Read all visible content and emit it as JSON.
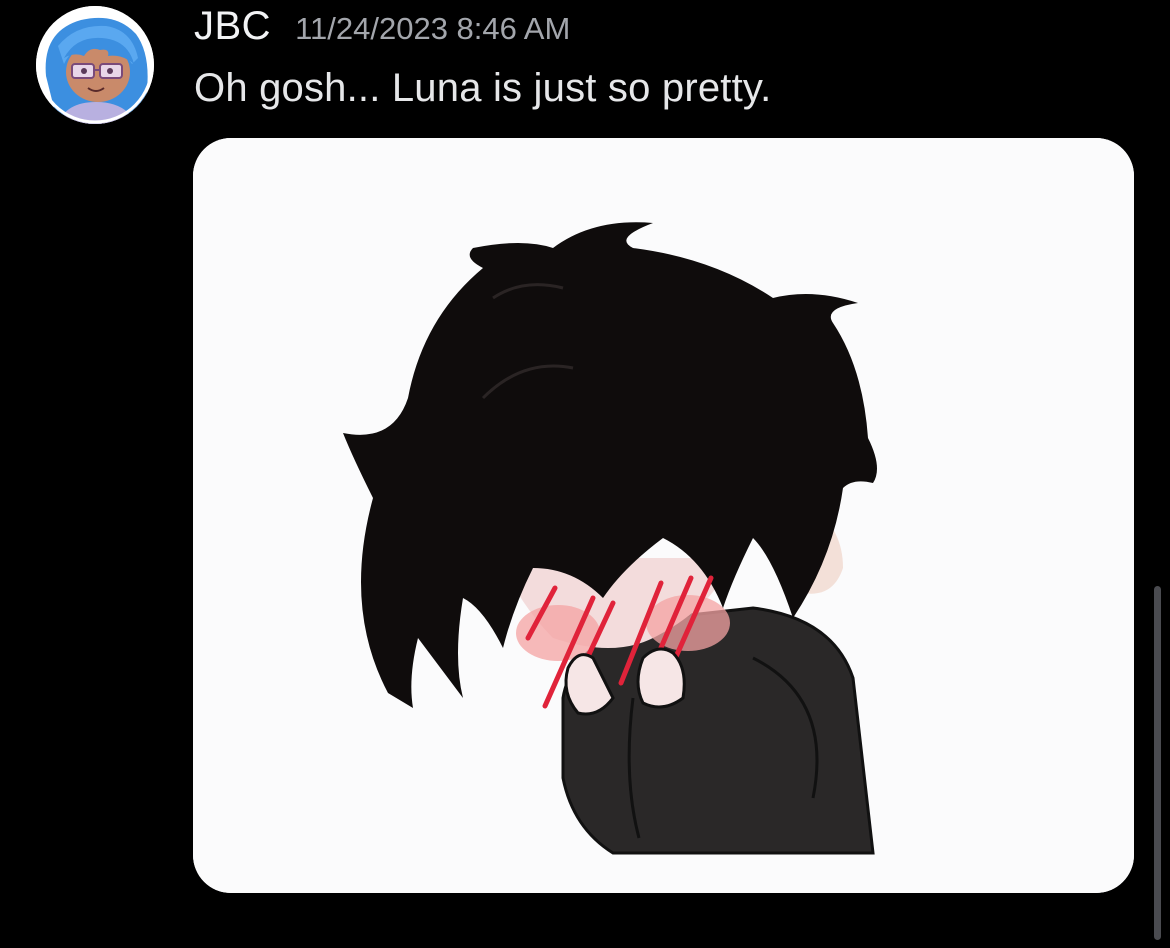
{
  "message": {
    "author": "JBC",
    "timestamp": "11/24/2023 8:46 AM",
    "content": "Oh gosh... Luna is just so pretty."
  },
  "avatar": {
    "icon": "user-avatar-icon"
  },
  "attachment": {
    "type": "image",
    "icon": "chibi-character-image"
  },
  "colors": {
    "background": "#000000",
    "username": "#f2f3f5",
    "timestamp": "#a3a6ac",
    "message_text": "#e6e7e9",
    "attachment_bg": "#fbfbfc",
    "scrollbar": "#4a4b50"
  }
}
